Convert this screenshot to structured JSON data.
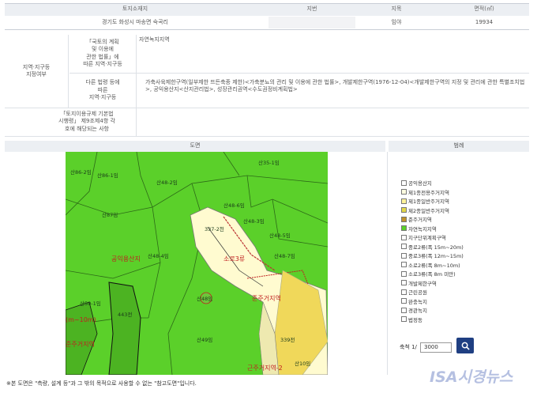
{
  "table": {
    "headers": {
      "location": "토지소재지",
      "lot_no": "지번",
      "land_category": "지목",
      "area": "면적(㎡)"
    },
    "row": {
      "location": "경기도 화성시 마송면 숙곡리",
      "lot_no": "",
      "land_category": "임야",
      "area": "19934"
    }
  },
  "zoning": {
    "group_label": "지역·지구등\n지정여부",
    "national_law_label": "「국토의 계획\n및 이용에\n관한 법률」에\n따른 지역·지구등",
    "national_law_value": "자연녹지지역",
    "other_law_label": "다른 법령 등에\n따른\n지역·지구등",
    "other_law_value": "가축사육제한구역(일부제한 뜨든축종 제한)<가축분뇨의 관리 및 이용에 관한 법률>, 개발제한구역(1976-12-04)<개발제한구역의 지정 및 관리에 관한 특별조치법>, 공익용산지<산지관리법>, 성장관리권역<수도권정비계획법>",
    "regulation_label": "「토지이용규제 기본법\n시행령」 제9조제4항 각\n호에 해당되는 사항",
    "regulation_value": ""
  },
  "map_section": {
    "title": "도면",
    "legend_title": "범례"
  },
  "map_labels": [
    "산86-2임",
    "산86-1임",
    "산35-1임",
    "산48-6임",
    "산48-2임",
    "산87임",
    "산48-4임",
    "산48-3임",
    "산48-5임",
    "산48-7임",
    "337-2천",
    "산50-1임",
    "443전",
    "산49임",
    "산48임",
    "339전",
    "산10임"
  ],
  "map_red_labels": [
    "공익용산지",
    "소로3류",
    "(m~10m)",
    "준주거지역",
    "준주거지역",
    "근주거지역-2"
  ],
  "legend": [
    {
      "label": "공익용산지",
      "color": "#ffffff"
    },
    {
      "label": "제1종전용주거지역",
      "color": "#fffde0"
    },
    {
      "label": "제1종일반주거지역",
      "color": "#fff29a"
    },
    {
      "label": "제2종일반주거지역",
      "color": "#e3d84a"
    },
    {
      "label": "준주거지역",
      "color": "#c0932c"
    },
    {
      "label": "자연녹지지역",
      "color": "#5bd02a"
    },
    {
      "label": "지구단위계획구역",
      "color": "#ffffff"
    },
    {
      "label": "중로2류(폭 15m~20m)",
      "color": "#ffffff"
    },
    {
      "label": "중로3류(폭 12m~15m)",
      "color": "#ffffff"
    },
    {
      "label": "소로2류(폭 8m~10m)",
      "color": "#ffffff"
    },
    {
      "label": "소로3류(폭 8m 미만)",
      "color": "#ffffff"
    },
    {
      "label": "개발제한구역",
      "color": "#ffffff"
    },
    {
      "label": "근린공원",
      "color": "#ffffff"
    },
    {
      "label": "완충녹지",
      "color": "#ffffff"
    },
    {
      "label": "경관녹지",
      "color": "#ffffff"
    },
    {
      "label": "법정동",
      "color": "#ffffff"
    }
  ],
  "scale": {
    "label": "축척 1/",
    "value": "3000"
  },
  "footnote": "※본 도면은 \"측량, 설계 등\"과 그 밖의 목적으로 사용할 수 없는 \"참고도면\"입니다.",
  "watermark": "ISA시경뉴스"
}
